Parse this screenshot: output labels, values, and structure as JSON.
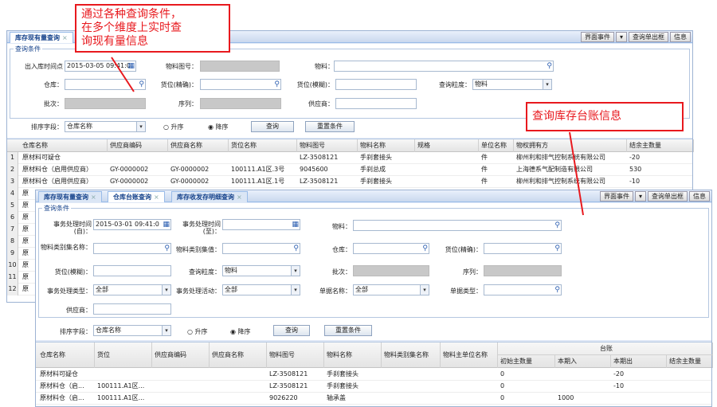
{
  "callout1": {
    "lines": [
      "通过各种查询条件，",
      "在多个维度上实时查",
      "询现有量信息"
    ]
  },
  "callout2": {
    "text": "查询库存台账信息"
  },
  "w1": {
    "tab": "库存现有量查询",
    "tab_close": "×",
    "btns": [
      "界面事件",
      "▾",
      "查询单出框",
      "信息"
    ],
    "legend": "查询条件",
    "f": {
      "io_time": "出入库时间点",
      "io_time_val": "2015-03-05 09:41:0",
      "tuhao": "物料图号：",
      "wuliao": "物料：",
      "cangku": "仓库：",
      "huowei_j": "货位(精确)：",
      "huowei_m": "货位(模糊)：",
      "lidu": "查询粒度：",
      "lidu_val": "物料",
      "pici": "批次：",
      "xulie": "序列：",
      "gys": "供应商："
    },
    "sort": {
      "label": "排序字段：",
      "val": "仓库名称",
      "asc": "升序",
      "desc": "降序",
      "query": "查询",
      "reset": "重置条件"
    },
    "cols": [
      "仓库名称",
      "供应商编码",
      "供应商名称",
      "货位名称",
      "物料图号",
      "物料名称",
      "规格",
      "单位名称",
      "物权拥有方",
      "结余主数量"
    ],
    "rows": [
      [
        "原材料可疑仓",
        "",
        "",
        "",
        "LZ-3508121",
        "手刹套接头",
        "",
        "件",
        "柳州利和排气控制系统有限公司",
        "-20"
      ],
      [
        "原材料仓（启用供应商）",
        "GY-0000002",
        "GY-0000002",
        "100111.A1区.3号",
        "9045600",
        "手刹总成",
        "",
        "件",
        "上海德系气配制造有限公司",
        "530"
      ],
      [
        "原材料仓（启用供应商）",
        "GY-0000002",
        "GY-0000002",
        "100111.A1区.1号",
        "LZ-3508121",
        "手刹套接头",
        "",
        "件",
        "柳州利和排气控制系统有限公司",
        "-10"
      ]
    ],
    "rn": [
      "1",
      "2",
      "3",
      "4",
      "5",
      "6",
      "7",
      "8",
      "9",
      "10",
      "11",
      "12"
    ],
    "stubs": [
      "原",
      "原",
      "原",
      "原",
      "原",
      "原",
      "原",
      "原",
      "原"
    ]
  },
  "w2": {
    "tabs": [
      "库存现有量查询",
      "仓库台账查询",
      "库存收发存明细查询"
    ],
    "tab_close": "×",
    "btns": [
      "界面事件",
      "▾",
      "查询单出框",
      "信息"
    ],
    "legend": "查询条件",
    "f": {
      "t1": "事务处理时间(自)：",
      "t1_val": "2015-03-01 09:41:0",
      "t2": "事务处理时间(至)：",
      "wl": "物料：",
      "lbjm": "物料类别集名称：",
      "lbjh": "物料类别集值：",
      "ck": "仓库：",
      "hwj": "货位(精确)：",
      "hwm": "货位(模糊)：",
      "ld": "查询粒度：",
      "ld_val": "物料",
      "pc": "批次：",
      "xl": "序列：",
      "lx": "事务处理类型：",
      "lx_val": "全部",
      "hd": "事务处理活动：",
      "hd_val": "全部",
      "djmc": "单据名称：",
      "djmc_val": "全部",
      "djlx": "单据类型：",
      "gys": "供应商："
    },
    "sort": {
      "label": "排序字段：",
      "val": "仓库名称",
      "asc": "升序",
      "desc": "降序",
      "query": "查询",
      "reset": "重置条件"
    },
    "cols": [
      "仓库名称",
      "货位",
      "供应商编码",
      "供应商名称",
      "物料图号",
      "物料名称",
      "物料类别集名称",
      "物料主单位名称"
    ],
    "group": "台账",
    "subcols": [
      "初始主数量",
      "本期入",
      "本期出",
      "结余主数量"
    ],
    "rows": [
      [
        "原材料可疑仓",
        "",
        "",
        "",
        "LZ-3508121",
        "手刹套接头",
        "",
        "",
        "0",
        "",
        "-20",
        ""
      ],
      [
        "原材料仓（启...",
        "100111.A1区...",
        "",
        "",
        "LZ-3508121",
        "手刹套接头",
        "",
        "",
        "0",
        "",
        "-10",
        ""
      ],
      [
        "原材料仓（启...",
        "100111.A1区...",
        "",
        "",
        "9026220",
        "轴承盖",
        "",
        "",
        "0",
        "1000",
        "",
        ""
      ]
    ]
  },
  "icons": {
    "search": "⚲",
    "cal": "▦"
  }
}
